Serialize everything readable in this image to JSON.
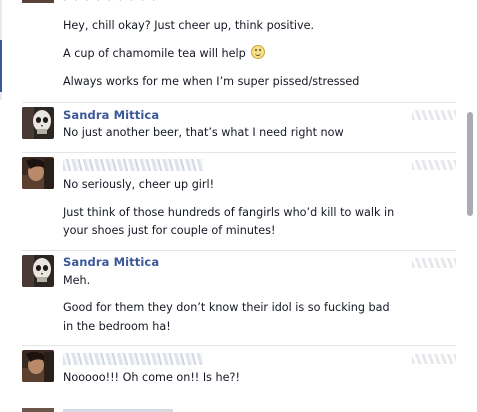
{
  "messages": [
    {
      "author": "",
      "lines": [
        "Hey, chill okay? Just cheer up, think positive.",
        "A cup of chamomile tea will help",
        "Always works for me when I’m super pissed/stressed"
      ],
      "top_ellipsis": "· · · · · · · · ·"
    },
    {
      "author": "Sandra Mittica",
      "lines": [
        "No just another beer, that’s what I need right now"
      ]
    },
    {
      "author": "",
      "lines": [
        "No seriously, cheer up girl!",
        "Just think of those hundreds of fangirls who’d kill to walk in",
        "your shoes just for couple of minutes!"
      ]
    },
    {
      "author": "Sandra Mittica",
      "lines": [
        "Meh.",
        "Good for them they don’t know their idol is so fucking bad",
        "in the bedroom ha!"
      ]
    },
    {
      "author": "",
      "lines": [
        "Nooooo!!! Oh come on!! Is he?!"
      ]
    }
  ],
  "icons": {
    "emoticon": "smiley-icon",
    "avatar_sandra": "skull-avatar",
    "avatar_friend": "friend-avatar"
  },
  "colors": {
    "author_link": "#3b5998",
    "text": "#141823",
    "separator": "#e5e5e5",
    "scroll_thumb": "#a8abb2"
  }
}
